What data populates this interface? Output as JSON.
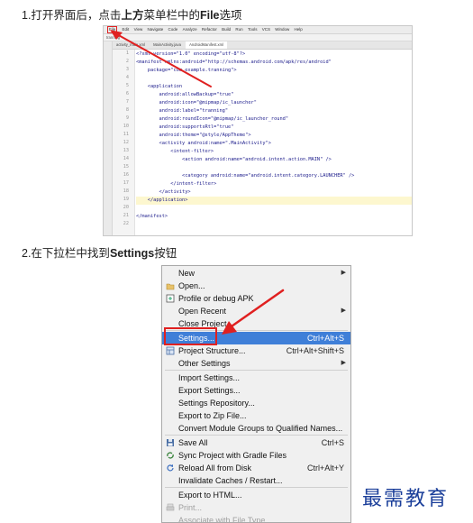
{
  "step1": {
    "prefix": "1.打开界面后，点击",
    "bold1": "上方",
    "middle": "菜单栏中的",
    "bold2": "File",
    "suffix": "选项"
  },
  "step2": {
    "prefix": "2.在下拉栏中找到",
    "bold": "Settings",
    "suffix": "按钮"
  },
  "ide": {
    "menu_items": [
      "File",
      "Edit",
      "View",
      "Navigate",
      "Code",
      "Analyze",
      "Refactor",
      "Build",
      "Run",
      "Tools",
      "VCS",
      "Window",
      "Help"
    ],
    "toolbar_text": "tranning",
    "tabs": [
      "activity_main.xml",
      "MainActivity.java",
      "AndroidManifest.xml"
    ],
    "line_numbers": [
      "1",
      "2",
      "3",
      "4",
      "5",
      "6",
      "7",
      "8",
      "9",
      "10",
      "11",
      "12",
      "13",
      "14",
      "15",
      "16",
      "17",
      "18",
      "19",
      "20",
      "21",
      "22"
    ],
    "code": [
      "<?xml version=\"1.0\" encoding=\"utf-8\"?>",
      "<manifest xmlns:android=\"http://schemas.android.com/apk/res/android\"",
      "    package=\"com.example.tranning\">",
      "",
      "    <application",
      "        android:allowBackup=\"true\"",
      "        android:icon=\"@mipmap/ic_launcher\"",
      "        android:label=\"tranning\"",
      "        android:roundIcon=\"@mipmap/ic_launcher_round\"",
      "        android:supportsRtl=\"true\"",
      "        android:theme=\"@style/AppTheme\">",
      "        <activity android:name=\".MainActivity\">",
      "            <intent-filter>",
      "                <action android:name=\"android.intent.action.MAIN\" />",
      "",
      "                <category android:name=\"android.intent.category.LAUNCHER\" />",
      "            </intent-filter>",
      "        </activity>",
      "    </application>",
      "",
      "</manifest>",
      ""
    ]
  },
  "menu": {
    "items": [
      {
        "label": "New",
        "shortcut": "",
        "submenu": true,
        "icon": "",
        "state": "normal"
      },
      {
        "label": "Open...",
        "shortcut": "",
        "submenu": false,
        "icon": "folder-icon",
        "state": "normal"
      },
      {
        "label": "Profile or debug APK",
        "shortcut": "",
        "submenu": false,
        "icon": "apk-icon",
        "state": "normal"
      },
      {
        "label": "Open Recent",
        "shortcut": "",
        "submenu": true,
        "icon": "",
        "state": "normal"
      },
      {
        "label": "Close Project",
        "shortcut": "",
        "submenu": false,
        "icon": "",
        "state": "normal"
      },
      {
        "label": "Settings...",
        "shortcut": "Ctrl+Alt+S",
        "submenu": false,
        "icon": "",
        "state": "selected"
      },
      {
        "label": "Project Structure...",
        "shortcut": "Ctrl+Alt+Shift+S",
        "submenu": false,
        "icon": "structure-icon",
        "state": "normal"
      },
      {
        "label": "Other Settings",
        "shortcut": "",
        "submenu": true,
        "icon": "",
        "state": "normal"
      },
      {
        "label": "Import Settings...",
        "shortcut": "",
        "submenu": false,
        "icon": "",
        "state": "normal"
      },
      {
        "label": "Export Settings...",
        "shortcut": "",
        "submenu": false,
        "icon": "",
        "state": "normal"
      },
      {
        "label": "Settings Repository...",
        "shortcut": "",
        "submenu": false,
        "icon": "",
        "state": "normal"
      },
      {
        "label": "Export to Zip File...",
        "shortcut": "",
        "submenu": false,
        "icon": "",
        "state": "normal"
      },
      {
        "label": "Convert Module Groups to Qualified Names...",
        "shortcut": "",
        "submenu": false,
        "icon": "",
        "state": "normal"
      },
      {
        "label": "Save All",
        "shortcut": "Ctrl+S",
        "submenu": false,
        "icon": "save-icon",
        "state": "normal"
      },
      {
        "label": "Sync Project with Gradle Files",
        "shortcut": "",
        "submenu": false,
        "icon": "sync-icon",
        "state": "normal"
      },
      {
        "label": "Reload All from Disk",
        "shortcut": "Ctrl+Alt+Y",
        "submenu": false,
        "icon": "reload-icon",
        "state": "normal"
      },
      {
        "label": "Invalidate Caches / Restart...",
        "shortcut": "",
        "submenu": false,
        "icon": "",
        "state": "normal"
      },
      {
        "label": "Export to HTML...",
        "shortcut": "",
        "submenu": false,
        "icon": "",
        "state": "normal"
      },
      {
        "label": "Print...",
        "shortcut": "",
        "submenu": false,
        "icon": "print-icon",
        "state": "disabled"
      },
      {
        "label": "Associate with File Type...",
        "shortcut": "",
        "submenu": false,
        "icon": "",
        "state": "disabled"
      }
    ]
  },
  "watermark": "最需教育",
  "colors": {
    "highlight": "#3f7fd8",
    "annotation_red": "#e02020",
    "watermark": "#1b3f9a"
  }
}
